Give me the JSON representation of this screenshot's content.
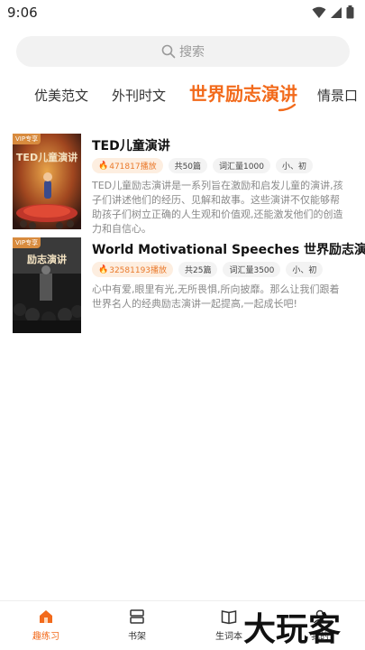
{
  "status": {
    "time": "9:06"
  },
  "search": {
    "placeholder": "搜索"
  },
  "tabs": [
    {
      "label": "优美范文",
      "active": false
    },
    {
      "label": "外刊时文",
      "active": false
    },
    {
      "label": "世界励志演讲",
      "active": true
    },
    {
      "label": "情景口",
      "active": false
    }
  ],
  "books": [
    {
      "badge": "VIP专享",
      "cover_title": "TED儿童演讲",
      "title": "TED儿童演讲",
      "plays": "471817播放",
      "count": "共50篇",
      "vocab": "词汇量1000",
      "level": "小、初",
      "description": "TED儿童励志演讲是一系列旨在激励和启发儿童的演讲,孩子们讲述他们的经历、见解和故事。这些演讲不仅能够帮助孩子们树立正确的人生观和价值观,还能激发他们的创造力和自信心。"
    },
    {
      "badge": "VIP专享",
      "cover_title": "励志演讲",
      "title": "World Motivational Speeches 世界励志演讲",
      "plays": "32581193播放",
      "count": "共25篇",
      "vocab": "词汇量3500",
      "level": "小、初",
      "description": "心中有爱,眼里有光,无所畏惧,所向披靡。那么让我们跟着世界名人的经典励志演讲一起提高,一起成长吧!"
    }
  ],
  "nav": [
    {
      "label": "趣练习",
      "icon": "home-icon",
      "active": true
    },
    {
      "label": "书架",
      "icon": "bookshelf-icon",
      "active": false
    },
    {
      "label": "生词本",
      "icon": "book-icon",
      "active": false
    },
    {
      "label": "我的",
      "icon": "person-icon",
      "active": false
    }
  ],
  "watermark": "大玩客",
  "colors": {
    "accent": "#f26a1b",
    "tag_hot_bg": "#fdeee0"
  }
}
